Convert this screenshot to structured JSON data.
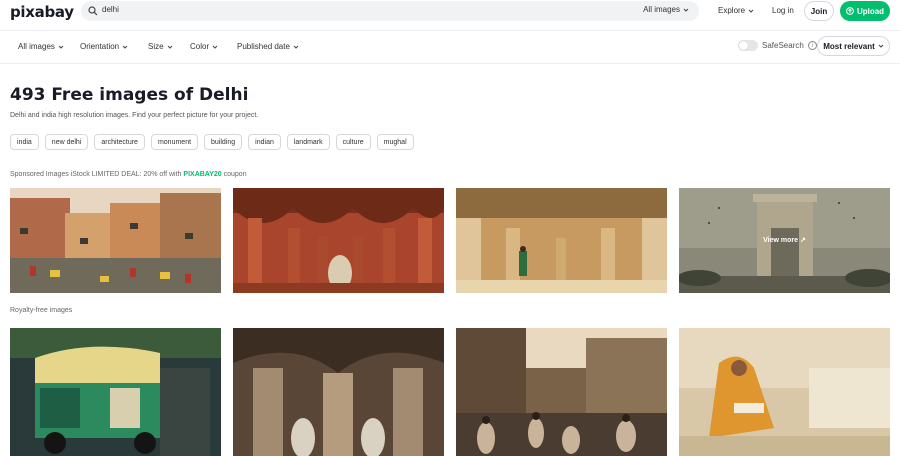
{
  "brand": {
    "logo": "pixabay",
    "accent": "#02be6e"
  },
  "search": {
    "query": "delhi",
    "type_selector": "All images"
  },
  "nav": {
    "explore": "Explore",
    "login": "Log in",
    "join": "Join",
    "upload": "Upload"
  },
  "filters": {
    "items": [
      "All images",
      "Orientation",
      "Size",
      "Color",
      "Published date"
    ],
    "safesearch": "SafeSearch",
    "sort": "Most relevant"
  },
  "heading": {
    "title": "493 Free images of Delhi",
    "subtitle": "Delhi and india high resolution images. Find your perfect picture for your project."
  },
  "tags": [
    "india",
    "new delhi",
    "architecture",
    "monument",
    "building",
    "indian",
    "landmark",
    "culture",
    "mughal"
  ],
  "sponsored": {
    "prefix": "Sponsored Images iStock LIMITED DEAL: 20% off with ",
    "code": "PIXABAY20",
    "suffix": " coupon"
  },
  "sponsored_images": [
    {
      "subject": "old delhi street"
    },
    {
      "subject": "red fort arches"
    },
    {
      "subject": "palace corridor"
    },
    {
      "subject": "india gate",
      "overlay": "View more"
    }
  ],
  "royalty_label": "Royalty-free images",
  "royalty_images": [
    {
      "subject": "auto rickshaw"
    },
    {
      "subject": "carved arches"
    },
    {
      "subject": "street market"
    },
    {
      "subject": "woman sitting"
    }
  ]
}
